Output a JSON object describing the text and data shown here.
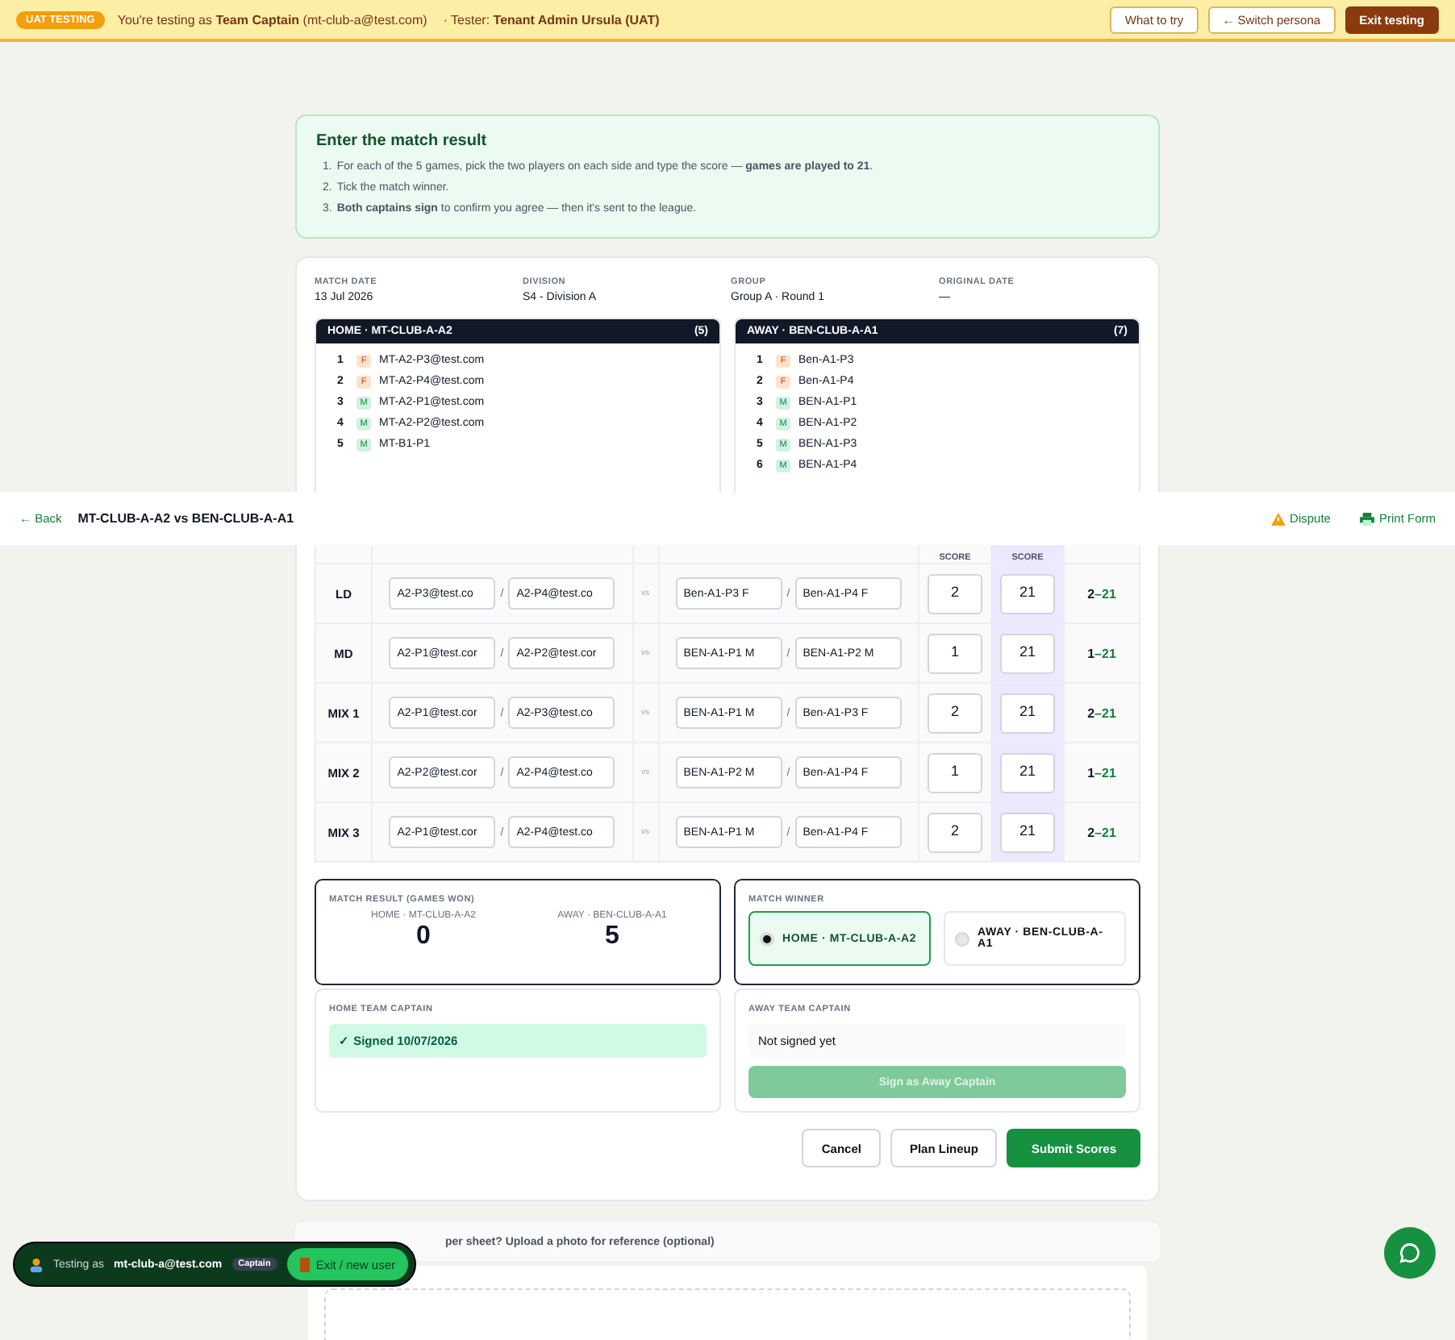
{
  "uat_banner": {
    "badge": "UAT TESTING",
    "message": "You're testing as **Team Captain** (mt-club-a@test.com)",
    "tester": "· Tester: **Tenant Admin Ursula (UAT)**",
    "buttons": [
      {
        "label": "What to try",
        "kind": "outline"
      },
      {
        "label": "← Switch persona",
        "kind": "outline"
      },
      {
        "label": "Exit testing",
        "kind": "primary"
      }
    ]
  },
  "instructions": {
    "title": "Enter the match result",
    "steps": [
      {
        "number": "1.",
        "text": "For each of the 5 games, pick the two players on each side and type the score — **games are played to 21**."
      },
      {
        "number": "2.",
        "text": "Tick the match winner."
      },
      {
        "number": "3.",
        "text": "**Both captains sign** to confirm you agree — then it's sent to the league."
      }
    ]
  },
  "match_info": [
    {
      "label": "MATCH DATE",
      "value": "13 Jul 2026"
    },
    {
      "label": "DIVISION",
      "value": "S4 - Division A"
    },
    {
      "label": "GROUP",
      "value": "Group A · Round 1"
    },
    {
      "label": "ORIGINAL DATE",
      "value": "—"
    }
  ],
  "teams": [
    {
      "title": "HOME · MT-CLUB-A-A2",
      "count": "(5)",
      "players": [
        {
          "number": "1",
          "gender": "F",
          "kind": "female",
          "name": "MT-A2-P3@test.com"
        },
        {
          "number": "2",
          "gender": "F",
          "kind": "female",
          "name": "MT-A2-P4@test.com"
        },
        {
          "number": "3",
          "gender": "M",
          "kind": "male",
          "name": "MT-A2-P1@test.com"
        },
        {
          "number": "4",
          "gender": "M",
          "kind": "male",
          "name": "MT-A2-P2@test.com"
        },
        {
          "number": "5",
          "gender": "M",
          "kind": "male",
          "name": "MT-B1-P1"
        }
      ]
    },
    {
      "title": "AWAY · BEN-CLUB-A-A1",
      "count": "(7)",
      "players": [
        {
          "number": "1",
          "gender": "F",
          "kind": "female",
          "name": "Ben-A1-P3"
        },
        {
          "number": "2",
          "gender": "F",
          "kind": "female",
          "name": "Ben-A1-P4"
        },
        {
          "number": "3",
          "gender": "M",
          "kind": "male",
          "name": "BEN-A1-P1"
        },
        {
          "number": "4",
          "gender": "M",
          "kind": "male",
          "name": "BEN-A1-P2"
        },
        {
          "number": "5",
          "gender": "M",
          "kind": "male",
          "name": "BEN-A1-P3"
        },
        {
          "number": "6",
          "gender": "M",
          "kind": "male",
          "name": "BEN-A1-P4"
        }
      ]
    }
  ],
  "top_bar": {
    "back": "← Back",
    "title": "MT-CLUB-A-A2 vs BEN-CLUB-A-A1",
    "dispute": "Dispute",
    "print": "Print Form"
  },
  "games_table": {
    "columns": [
      "SCORE",
      "SCORE"
    ],
    "rows": [
      {
        "game": "LD",
        "home": [
          "A2-P3@test.co",
          "A2-P4@test.co"
        ],
        "separators": [
          "/",
          "/"
        ],
        "points_separator": "–",
        "vs": "vs",
        "away": [
          "Ben-A1-P3 F",
          "Ben-A1-P4 F"
        ],
        "home_score": "2",
        "away_score": "21",
        "points_home": "2",
        "points_away": "21"
      },
      {
        "game": "MD",
        "home": [
          "A2-P1@test.cor",
          "A2-P2@test.cor"
        ],
        "separators": [
          "/",
          "/"
        ],
        "points_separator": "–",
        "vs": "vs",
        "away": [
          "BEN-A1-P1 M",
          "BEN-A1-P2 M"
        ],
        "home_score": "1",
        "away_score": "21",
        "points_home": "1",
        "points_away": "21"
      },
      {
        "game": "MIX 1",
        "home": [
          "A2-P1@test.cor",
          "A2-P3@test.co"
        ],
        "separators": [
          "/",
          "/"
        ],
        "points_separator": "–",
        "vs": "vs",
        "away": [
          "BEN-A1-P1 M",
          "Ben-A1-P3 F"
        ],
        "home_score": "2",
        "away_score": "21",
        "points_home": "2",
        "points_away": "21"
      },
      {
        "game": "MIX 2",
        "home": [
          "A2-P2@test.cor",
          "A2-P4@test.co"
        ],
        "separators": [
          "/",
          "/"
        ],
        "points_separator": "–",
        "vs": "vs",
        "away": [
          "BEN-A1-P2 M",
          "Ben-A1-P4 F"
        ],
        "home_score": "1",
        "away_score": "21",
        "points_home": "1",
        "points_away": "21"
      },
      {
        "game": "MIX 3",
        "home": [
          "A2-P1@test.cor",
          "A2-P4@test.co"
        ],
        "separators": [
          "/",
          "/"
        ],
        "points_separator": "–",
        "vs": "vs",
        "away": [
          "BEN-A1-P1 M",
          "Ben-A1-P4 F"
        ],
        "home_score": "2",
        "away_score": "21",
        "points_home": "2",
        "points_away": "21"
      }
    ]
  },
  "match_result": {
    "title": "MATCH RESULT (GAMES WON)",
    "home_label": "HOME · MT-CLUB-A-A2",
    "home_value": "0",
    "away_label": "AWAY · BEN-CLUB-A-A1",
    "away_value": "5"
  },
  "match_winner": {
    "title": "MATCH WINNER",
    "options": [
      {
        "label": "HOME · MT-CLUB-A-A2",
        "selected": true
      },
      {
        "label": "AWAY · BEN-CLUB-A-A1",
        "selected": false
      }
    ]
  },
  "captains": [
    {
      "title": "HOME TEAM CAPTAIN",
      "signed": true,
      "status": "✓ Signed 10/07/2026"
    },
    {
      "title": "AWAY TEAM CAPTAIN",
      "signed": false,
      "status": "Not signed yet",
      "button": "Sign as Away Captain",
      "disabled": true
    }
  ],
  "actions": [
    {
      "label": "Cancel",
      "kind": "secondary"
    },
    {
      "label": "Plan Lineup",
      "kind": "secondary"
    },
    {
      "label": "Submit Scores",
      "kind": "primary"
    }
  ],
  "upload": {
    "prompt": "per sheet? Upload a photo for reference (optional)"
  },
  "testing_pill": {
    "prefix": "Testing as",
    "email": "mt-club-a@test.com",
    "role": "Captain",
    "exit": "Exit / new user"
  }
}
